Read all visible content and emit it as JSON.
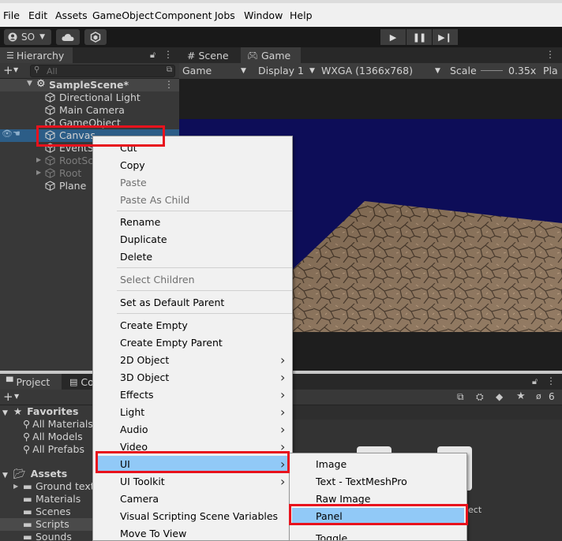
{
  "menubar": {
    "items": [
      "File",
      "Edit",
      "Assets",
      "GameObject",
      "Component",
      "Jobs",
      "Window",
      "Help"
    ]
  },
  "toolbar": {
    "account_label": "SO"
  },
  "hierarchy": {
    "tab_label": "Hierarchy",
    "search_placeholder": "All",
    "scene_name": "SampleScene*",
    "items": [
      {
        "label": "Directional Light",
        "state": "normal"
      },
      {
        "label": "Main Camera",
        "state": "normal"
      },
      {
        "label": "GameObject",
        "state": "normal"
      },
      {
        "label": "Canvas",
        "state": "selected"
      },
      {
        "label": "EventS",
        "state": "normal"
      },
      {
        "label": "RootSc",
        "state": "dim"
      },
      {
        "label": "Root",
        "state": "dim"
      },
      {
        "label": "Plane",
        "state": "normal"
      }
    ]
  },
  "gameview": {
    "tabs": [
      "Scene",
      "Game"
    ],
    "controls": {
      "mode": "Game",
      "display": "Display 1",
      "resolution": "WXGA (1366x768)",
      "scale_label": "Scale",
      "scale_value": "0.35x",
      "play_label": "Pla"
    }
  },
  "project": {
    "tabs": [
      "Project",
      "Co"
    ],
    "hidden_count": "6",
    "favorites": {
      "title": "Favorites",
      "items": [
        "All Materials",
        "All Models",
        "All Prefabs"
      ]
    },
    "assets": {
      "title": "Assets",
      "items": [
        "Ground textu",
        "Materials",
        "Scenes",
        "Scripts",
        "Sounds"
      ]
    },
    "grid_partial_label": "ect"
  },
  "context_menu": {
    "items": [
      {
        "label": "Cut",
        "disabled": false
      },
      {
        "label": "Copy",
        "disabled": false
      },
      {
        "label": "Paste",
        "disabled": true
      },
      {
        "label": "Paste As Child",
        "disabled": true
      },
      {
        "label": "Rename",
        "disabled": false
      },
      {
        "label": "Duplicate",
        "disabled": false
      },
      {
        "label": "Delete",
        "disabled": false
      },
      {
        "label": "Select Children",
        "disabled": true
      },
      {
        "label": "Set as Default Parent",
        "disabled": false
      },
      {
        "label": "Create Empty",
        "disabled": false
      },
      {
        "label": "Create Empty Parent",
        "disabled": false
      },
      {
        "label": "2D Object",
        "disabled": false,
        "submenu": true
      },
      {
        "label": "3D Object",
        "disabled": false,
        "submenu": true
      },
      {
        "label": "Effects",
        "disabled": false,
        "submenu": true
      },
      {
        "label": "Light",
        "disabled": false,
        "submenu": true
      },
      {
        "label": "Audio",
        "disabled": false,
        "submenu": true
      },
      {
        "label": "Video",
        "disabled": false,
        "submenu": true
      },
      {
        "label": "UI",
        "disabled": false,
        "submenu": true,
        "highlighted": true
      },
      {
        "label": "UI Toolkit",
        "disabled": false,
        "submenu": true
      },
      {
        "label": "Camera",
        "disabled": false
      },
      {
        "label": "Visual Scripting Scene Variables",
        "disabled": false
      },
      {
        "label": "Move To View",
        "disabled": false
      }
    ]
  },
  "ui_submenu": {
    "items": [
      {
        "label": "Image"
      },
      {
        "label": "Text - TextMeshPro"
      },
      {
        "label": "Raw Image"
      },
      {
        "label": "Panel",
        "highlighted": true
      },
      {
        "label": "Toggle"
      }
    ]
  },
  "colors": {
    "highlight_red": "#e8121d",
    "menu_hover": "#91c9f7",
    "selection_blue": "#2c5d87",
    "sky": "#0d0d58"
  }
}
